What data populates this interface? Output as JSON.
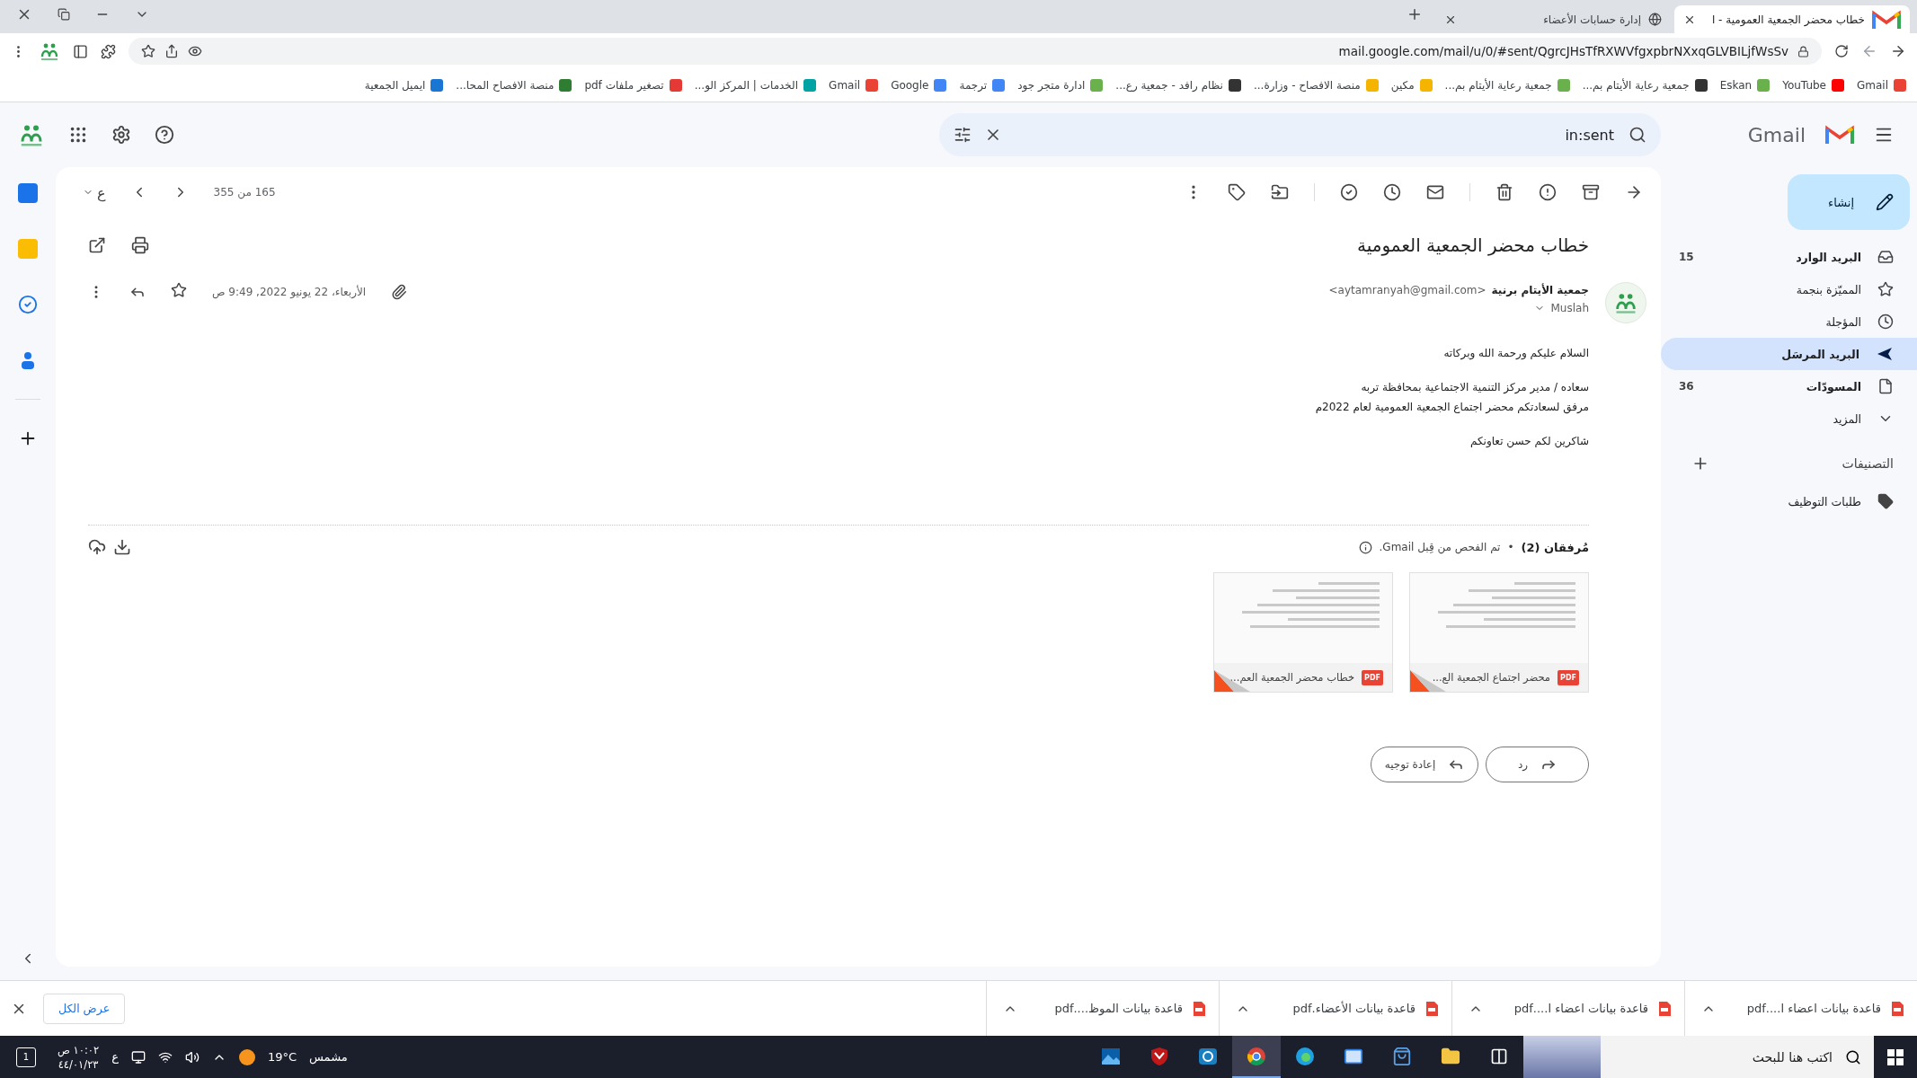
{
  "browser": {
    "tabs": [
      {
        "title": "خطاب محضر الجمعية العمومية - ا",
        "selected": true
      },
      {
        "title": "إدارة حسابات الأعضاء",
        "selected": false
      }
    ],
    "address": "mail.google.com/mail/u/0/#sent/QgrcJHsTfRXWVfgxpbrNXxqGLVBILjfWsSv",
    "bookmarks": [
      {
        "label": "Gmail"
      },
      {
        "label": "YouTube"
      },
      {
        "label": "Eskan"
      },
      {
        "label": "جمعية رعاية الأيتام بم..."
      },
      {
        "label": "جمعية رعاية الأيتام بم..."
      },
      {
        "label": "مكين"
      },
      {
        "label": "منصة الافصاح - وزارة..."
      },
      {
        "label": "نظام رافد - جمعية رع..."
      },
      {
        "label": "ادارة متجر جود"
      },
      {
        "label": "ترجمة"
      },
      {
        "label": "Google"
      },
      {
        "label": "Gmail"
      },
      {
        "label": "الخدمات | المركز الو..."
      },
      {
        "label": "تصغير ملفات pdf"
      },
      {
        "label": "منصة الافصاح المحا..."
      },
      {
        "label": "ايميل الجمعية"
      }
    ]
  },
  "gmail": {
    "product": "Gmail",
    "search": {
      "value": "in:sent"
    },
    "compose": "إنشاء",
    "nav": [
      {
        "label": "البريد الوارد",
        "count": "15",
        "unread": true,
        "selected": false
      },
      {
        "label": "المميّزة بنجمة",
        "unread": false,
        "selected": false
      },
      {
        "label": "المؤجلة",
        "unread": false,
        "selected": false
      },
      {
        "label": "البريد المرسَل",
        "unread": false,
        "selected": true
      },
      {
        "label": "المسودّات",
        "count": "36",
        "unread": true,
        "selected": false
      },
      {
        "label": "المزيد",
        "unread": false,
        "selected": false
      }
    ],
    "labels_title": "التصنيفات",
    "labels": [
      "طلبات التوظيف"
    ],
    "pager": "165 من 355",
    "input_tool": "ع",
    "message": {
      "subject": "خطاب محضر الجمعية العمومية",
      "sender_name": "جمعية الأيتام برنية",
      "sender_email": "<aytamranyah@gmail.com>",
      "recipient": "Muslah",
      "date": "الأربعاء، 22 يونيو 2022, 9:49 ص",
      "starred": false,
      "paragraphs": [
        [
          "السلام عليكم ورحمة الله وبركاته"
        ],
        [
          "سعاده / مدير مركز التنمية الاجتماعية بمحافظة تربه",
          "مرفق لسعادتكم محضر اجتماع الجمعية العمومية لعام 2022م"
        ],
        [
          "شاكرين لكم حسن تعاونكم"
        ]
      ]
    },
    "attachments": {
      "title": "مُرفقان (2)",
      "separator": "•",
      "note": "تم الفحص من قِبل Gmail.",
      "files": [
        {
          "name": "محضر اجتماع الجمعية الع...",
          "type": "PDF"
        },
        {
          "name": "خطاب محضر الجمعية العم...",
          "type": "PDF"
        }
      ]
    },
    "actions": {
      "reply": "رد",
      "forward": "إعادة توجيه"
    }
  },
  "downloads": {
    "items": [
      {
        "name": "قاعدة بيانات اعضاء ا....pdf"
      },
      {
        "name": "قاعدة بيانات اعضاء ا....pdf"
      },
      {
        "name": "قاعدة بيانات الأعضاء.pdf"
      },
      {
        "name": "قاعدة بيانات الموظ....pdf"
      }
    ],
    "show_all": "عرض الكل"
  },
  "taskbar": {
    "search_placeholder": "اكتب هنا للبحث",
    "apps": [
      {
        "selected": false
      },
      {
        "selected": false
      },
      {
        "selected": false
      },
      {
        "selected": false
      },
      {
        "selected": true
      },
      {
        "selected": false
      },
      {
        "selected": false
      },
      {
        "selected": false
      }
    ],
    "weather": "مشمس",
    "temperature": "19°C",
    "language": "ع",
    "time": "١٠:٠٢ ص",
    "date": "٤٤/٠١/٢٣",
    "notifications": "1"
  }
}
